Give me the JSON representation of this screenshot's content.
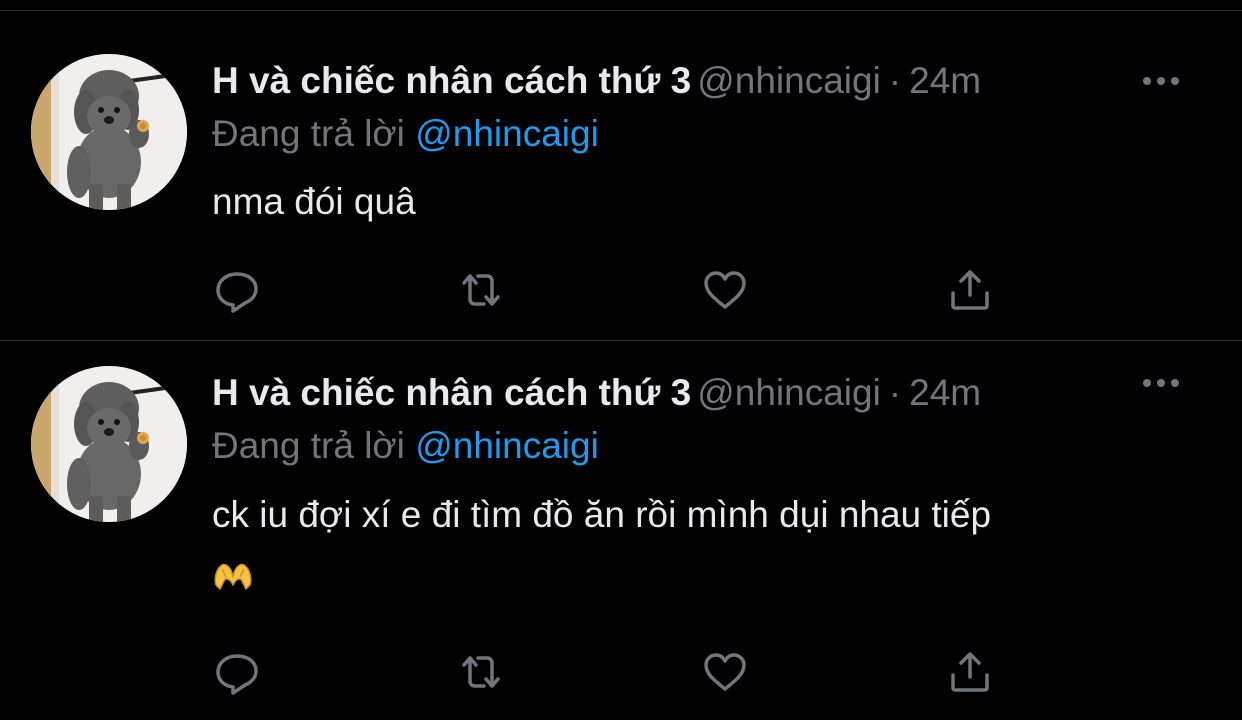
{
  "tweets": [
    {
      "display_name": "H và chiếc nhân cách thứ 3",
      "handle": "@nhincaigi",
      "separator": "·",
      "time": "24m",
      "reply_prefix": "Đang trả lời",
      "reply_mention": "@nhincaigi",
      "text": "nma đói quâ",
      "emoji": ""
    },
    {
      "display_name": "H và chiếc nhân cách thứ 3",
      "handle": "@nhincaigi",
      "separator": "·",
      "time": "24m",
      "reply_prefix": "Đang trả lời",
      "reply_mention": "@nhincaigi",
      "text": "ck iu đợi xí e đi tìm đồ ăn rồi mình dụi nhau tiếp",
      "emoji": "heart-hands"
    }
  ],
  "icons": {
    "reply": "reply-icon",
    "retweet": "retweet-icon",
    "like": "like-icon",
    "share": "share-icon",
    "more": "more-icon"
  },
  "colors": {
    "background": "#000000",
    "text": "#e7e9ea",
    "muted": "#71767b",
    "mention": "#1d9bf0",
    "divider": "#2f3336"
  }
}
